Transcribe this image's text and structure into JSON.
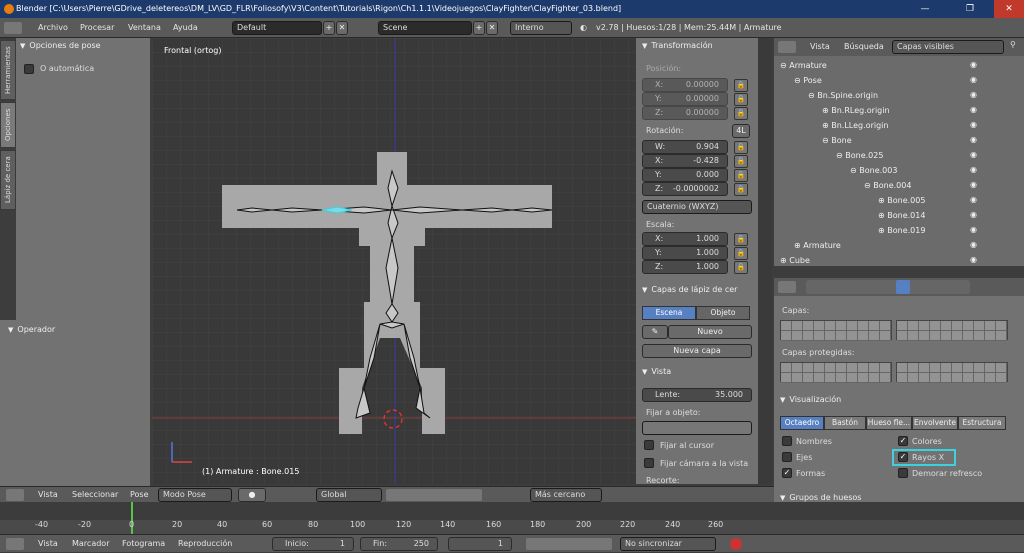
{
  "window": {
    "title": "Blender [C:\\Users\\Pierre\\GDrive_deletereos\\DM_LV\\GD_FLR\\Foliosofy\\V3\\Content\\Tutorials\\Rigon\\Ch1.1.1\\Videojuegos\\ClayFighter\\ClayFighter_03.blend]",
    "min": "—",
    "max": "❐",
    "close": "✕"
  },
  "menu": {
    "items": [
      "Archivo",
      "Procesar",
      "Ventana",
      "Ayuda"
    ],
    "layout": "Default",
    "scene": "Scene",
    "engine": "Interno",
    "version": "v2.78 | Huesos:1/28 | Mem:25.44M | Armature"
  },
  "left_tabs": [
    "Herramientas",
    "Opciones",
    "Lápiz de cera"
  ],
  "tool_panel": {
    "header": "Opciones de pose",
    "auto_label": "O automática",
    "operator": "Operador"
  },
  "viewport": {
    "view_name": "Frontal (ortog)",
    "status": "(1) Armature : Bone.015"
  },
  "transform": {
    "header": "Transformación",
    "position_label": "Posición:",
    "position": [
      {
        "axis": "X:",
        "value": "0.00000"
      },
      {
        "axis": "Y:",
        "value": "0.00000"
      },
      {
        "axis": "Z:",
        "value": "0.00000"
      }
    ],
    "rotation_label": "Rotación:",
    "rot_mode_btn": "4L",
    "rotation": [
      {
        "axis": "W:",
        "value": "0.904"
      },
      {
        "axis": "X:",
        "value": "-0.428"
      },
      {
        "axis": "Y:",
        "value": "0.000"
      },
      {
        "axis": "Z:",
        "value": "-0.0000002"
      }
    ],
    "rot_type": "Cuaternio (WXYZ)",
    "scale_label": "Escala:",
    "scale": [
      {
        "axis": "X:",
        "value": "1.000"
      },
      {
        "axis": "Y:",
        "value": "1.000"
      },
      {
        "axis": "Z:",
        "value": "1.000"
      }
    ]
  },
  "grease": {
    "header": "Capas de lápiz de cer",
    "tab_scene": "Escena",
    "tab_object": "Objeto",
    "new_label": "Nuevo",
    "new_layer": "Nueva capa"
  },
  "view_panel": {
    "header": "Vista",
    "lens_label": "Lente:",
    "lens_value": "35.000",
    "lock_label": "Fijar a objeto:",
    "lock_cursor": "Fijar al cursor",
    "lock_camera": "Fijar cámara a la vista",
    "recorte": "Recorte:"
  },
  "outliner": {
    "view": "Vista",
    "search": "Búsqueda",
    "filter": "Capas visibles",
    "rows": [
      "Armature",
      "Pose",
      "Bn.Spine.origin",
      "Bn.RLeg.origin",
      "Bn.LLeg.origin",
      "Bone",
      "Bone.025",
      "Bone.003",
      "Bone.004",
      "Bone.005",
      "Bone.014",
      "Bone.019",
      "Armature",
      "Cube"
    ]
  },
  "properties": {
    "layers_label": "Capas:",
    "protected_label": "Capas protegidas:",
    "display_header": "Visualización",
    "display_tabs": [
      "Octaedro",
      "Bastón",
      "Hueso fle...",
      "Envolvente",
      "Estructura"
    ],
    "options": {
      "names": "Nombres",
      "axes": "Ejes",
      "shapes": "Formas",
      "colors": "Colores",
      "xray": "Rayos X",
      "delay": "Demorar refresco"
    },
    "groups_header": "Grupos de huesos"
  },
  "view3d_header": {
    "view": "Vista",
    "select": "Seleccionar",
    "pose": "Pose",
    "mode": "Modo Pose",
    "orientation": "Global",
    "snap": "Más cercano"
  },
  "timeline": {
    "ticks": [
      "-40",
      "-20",
      "0",
      "20",
      "40",
      "60",
      "80",
      "100",
      "120",
      "140",
      "160",
      "180",
      "200",
      "220",
      "240",
      "260"
    ],
    "view": "Vista",
    "marker": "Marcador",
    "frame": "Fotograma",
    "playback": "Reproducción",
    "start_label": "Inicio:",
    "start": "1",
    "end_label": "Fin:",
    "end": "250",
    "current": "1",
    "sync": "No sincronizar"
  },
  "colors": {
    "accent": "#5680c2",
    "highlight": "#3fd0e0"
  }
}
